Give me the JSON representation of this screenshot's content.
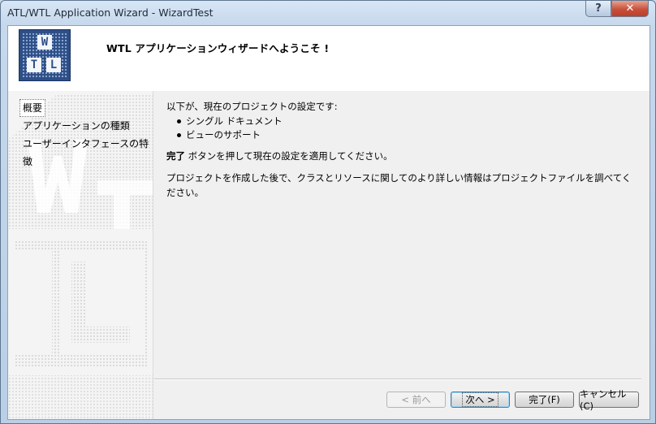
{
  "window": {
    "title": "ATL/WTL Application Wizard - WizardTest",
    "help_label": "?",
    "close_label": "✕"
  },
  "header": {
    "logo_letters": [
      "W",
      "T",
      "L"
    ],
    "welcome": "WTL アプリケーションウィザードへようこそ !"
  },
  "sidebar": {
    "items": [
      {
        "label": "概要"
      },
      {
        "label": "アプリケーションの種類"
      },
      {
        "label": "ユーザーインタフェースの特徴"
      }
    ]
  },
  "content": {
    "intro": "以下が、現在のプロジェクトの設定です:",
    "settings": [
      "シングル ドキュメント",
      "ビューのサポート"
    ],
    "finish_word": "完了",
    "finish_rest": " ボタンを押して現在の設定を適用してください。",
    "info": "プロジェクトを作成した後で、クラスとリソースに関してのより詳しい情報はプロジェクトファイルを調べてください。"
  },
  "buttons": {
    "back": "< 前へ",
    "next": "次へ >",
    "finish": "完了(F)",
    "cancel": "キャンセル(C)"
  }
}
